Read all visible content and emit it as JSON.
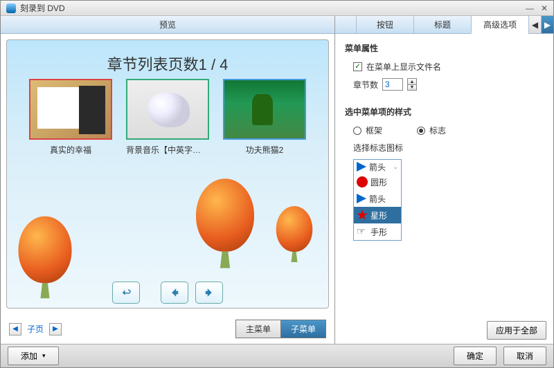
{
  "window": {
    "title": "刻录到 DVD"
  },
  "left": {
    "header": "预览",
    "chapter_page": "章节列表页数1 / 4",
    "thumbs": [
      "真实的幸福",
      "背景音乐【中英字幕】Vict",
      "功夫熊猫2"
    ],
    "pager_label": "子页",
    "menu_btns": [
      "主菜单",
      "子菜单"
    ]
  },
  "right": {
    "tabs": [
      "按钮",
      "标题",
      "高级选项"
    ],
    "section1": "菜单属性",
    "show_filename": "在菜单上显示文件名",
    "chapter_count_label": "章节数",
    "chapter_count_value": "3",
    "section2": "选中菜单项的样式",
    "radio": [
      "框架",
      "标志"
    ],
    "choose_mark": "选择标志图标",
    "mark_options": [
      "箭头",
      "圆形",
      "箭头",
      "星形",
      "手形"
    ],
    "apply_all": "应用于全部"
  },
  "footer": {
    "add": "添加",
    "ok": "确定",
    "cancel": "取消"
  }
}
